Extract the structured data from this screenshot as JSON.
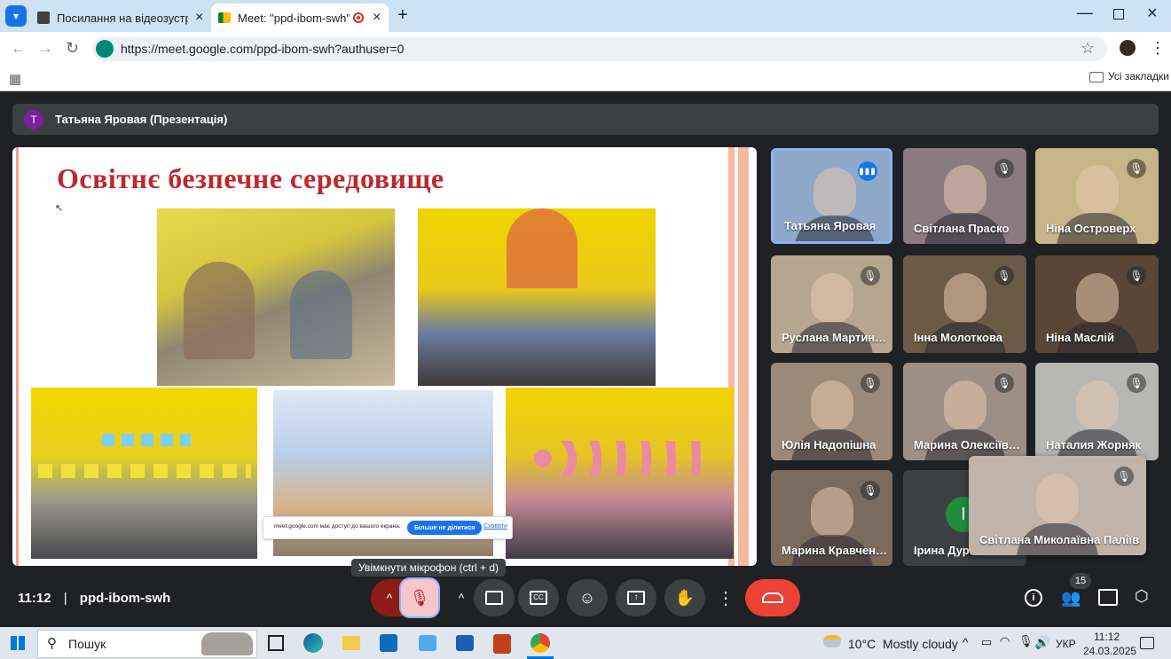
{
  "browser": {
    "tabs": [
      {
        "title": "Посилання на відеозустріч Go",
        "active": false
      },
      {
        "title": "Meet: \"ppd-ibom-swh\"",
        "active": true
      }
    ],
    "url": "https://meet.google.com/ppd-ibom-swh?authuser=0",
    "bookmarks_label": "Усі закладки"
  },
  "presentation": {
    "presenter_initial": "T",
    "header_label": "Татьяна Яровая (Презентація)",
    "slide_title": "Освітнє безпечне середовище",
    "share_bar": {
      "text": "meet.google.com має доступ до вашого екрана.",
      "stop_label": "Більше не ділитися",
      "hide_label": "Сховати"
    }
  },
  "participants": [
    {
      "name": "Татьяна Яровая",
      "speaking": true,
      "bg": "#8fa8c9"
    },
    {
      "name": "Світлана Праско",
      "speaking": false,
      "bg": "#8a7b80"
    },
    {
      "name": "Ніна Островерх",
      "speaking": false,
      "bg": "#c7b58a"
    },
    {
      "name": "Руслана Мартин…",
      "speaking": false,
      "bg": "#b6a68f"
    },
    {
      "name": "Інна Молоткова",
      "speaking": false,
      "bg": "#6b5a45"
    },
    {
      "name": "Ніна Маслій",
      "speaking": false,
      "bg": "#5a4636"
    },
    {
      "name": "Юлія Надопішна",
      "speaking": false,
      "bg": "#9b8a7a"
    },
    {
      "name": "Марина Олексіїв…",
      "speaking": false,
      "bg": "#9d8f86"
    },
    {
      "name": "Наталия Жорняк",
      "speaking": false,
      "bg": "#b7b7b4"
    },
    {
      "name": "Марина Кравчен…",
      "speaking": false,
      "bg": "#7a6b5e"
    },
    {
      "name": "Ірина Дурі…",
      "speaking": false,
      "bg": "#3c4043",
      "initial": "І"
    },
    {
      "name": "Світлана Миколаївна Паліїв…",
      "speaking": false,
      "bg": "#bfb3aa"
    }
  ],
  "meeting": {
    "time": "11:12",
    "code": "ppd-ibom-swh",
    "mic_tooltip": "Увімкнути мікрофон (ctrl + d)",
    "people_count": "15"
  },
  "taskbar": {
    "search_label": "Пошук",
    "weather": "10°C  Mostly cloudy",
    "lang": "УКР",
    "clock_time": "11:12",
    "clock_date": "24.03.2025"
  },
  "colors": {
    "end_call": "#ea4335",
    "mic_active": "#f5c6cb",
    "accent": "#8ab4f8"
  }
}
